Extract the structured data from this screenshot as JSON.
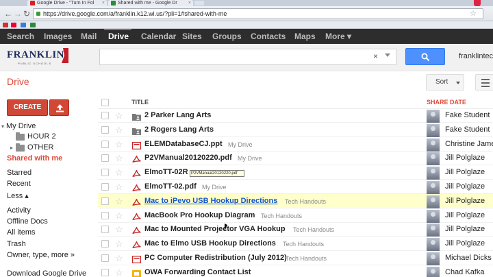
{
  "browser": {
    "tabs": [
      {
        "label": "Google Drive - \"Turn In Fol",
        "icon": "youtube-icon",
        "color": "#d62020"
      },
      {
        "label": "Shared with me - Google Dr",
        "icon": "drive-icon",
        "color": "#2a8a3e"
      }
    ],
    "url": "https://drive.google.com/a/franklin.k12.wi.us/?pli=1#shared-with-me"
  },
  "gbar": {
    "items": [
      "Search",
      "Images",
      "Mail",
      "Drive",
      "Calendar",
      "Sites",
      "Groups",
      "Contacts",
      "Maps",
      "More ▾"
    ],
    "active": "Drive"
  },
  "header": {
    "logo_text": "FRANKLIN",
    "logo_sub": "PUBLIC SCHOOLS",
    "search_clear": "×",
    "user": "franklintec"
  },
  "drive": {
    "title": "Drive",
    "create_label": "CREATE",
    "sort_label": "Sort",
    "columns": {
      "title": "TITLE",
      "date": "SHARE DATE"
    }
  },
  "nav": {
    "my_drive": "My Drive",
    "hour2": "HOUR 2",
    "other": "OTHER",
    "shared": "Shared with me",
    "starred": "Starred",
    "recent": "Recent",
    "less": "Less ▴",
    "activity": "Activity",
    "offline": "Offline Docs",
    "all_items": "All items",
    "trash": "Trash",
    "owner_type": "Owner, type, more »",
    "download": "Download Google Drive"
  },
  "files": [
    {
      "name": "2 Parker Lang Arts",
      "collection": "",
      "owner": "Fake Student",
      "type": "shared-folder"
    },
    {
      "name": "2 Rogers Lang Arts",
      "collection": "",
      "owner": "Fake Student",
      "type": "shared-folder"
    },
    {
      "name": "ELEMDatabaseCJ.ppt",
      "collection": "My Drive",
      "owner": "Christine Jame",
      "type": "ppt"
    },
    {
      "name": "P2VManual20120220.pdf",
      "collection": "My Drive",
      "owner": "Jill Polglaze",
      "type": "pdf"
    },
    {
      "name": "ElmoTT-02R",
      "collection": "",
      "owner": "Jill Polglaze",
      "type": "pdf"
    },
    {
      "name": "ElmoTT-02.pdf",
      "collection": "My Drive",
      "owner": "Jill Polglaze",
      "type": "pdf"
    },
    {
      "name": "Mac to iPevo USB Hookup Directions",
      "collection": "Tech Handouts",
      "owner": "Jill Polglaze",
      "type": "pdf"
    },
    {
      "name": "MacBook Pro Hookup Diagram",
      "collection": "Tech Handouts",
      "owner": "Jill Polglaze",
      "type": "pdf"
    },
    {
      "name": "Mac to Mounted Projector VGA Hookup",
      "collection": "Tech Handouts",
      "owner": "Jill Polglaze",
      "type": "pdf"
    },
    {
      "name": "Mac to Elmo USB Hookup Directions",
      "collection": "Tech Handouts",
      "owner": "Jill Polglaze",
      "type": "pdf"
    },
    {
      "name": "PC Computer Redistribution (July 2012)",
      "collection": "Tech Handouts",
      "owner": "Michael Dicks",
      "type": "ppt"
    },
    {
      "name": "OWA Forwarding Contact List",
      "collection": "",
      "owner": "Chad Kafka",
      "type": "slides"
    }
  ],
  "tooltip": "P2VManual20120220.pdf",
  "colors": {
    "accent": "#dd4b39",
    "create": "#d14836",
    "search": "#4d90fe",
    "highlight": "#ffffcc",
    "link": "#1155cc"
  }
}
